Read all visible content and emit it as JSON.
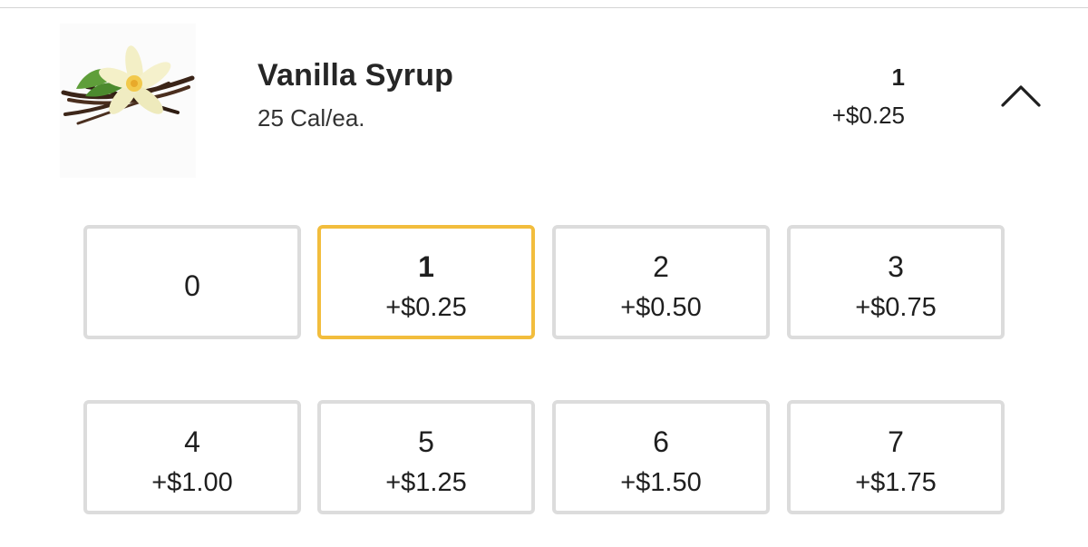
{
  "item": {
    "name": "Vanilla Syrup",
    "calories": "25 Cal/ea.",
    "image_icon": "vanilla-flower-icon"
  },
  "selection": {
    "quantity": "1",
    "price": "+$0.25",
    "collapse_icon": "chevron-up-icon"
  },
  "options": [
    {
      "qty": "0",
      "price": "",
      "selected": false
    },
    {
      "qty": "1",
      "price": "+$0.25",
      "selected": true
    },
    {
      "qty": "2",
      "price": "+$0.50",
      "selected": false
    },
    {
      "qty": "3",
      "price": "+$0.75",
      "selected": false
    },
    {
      "qty": "4",
      "price": "+$1.00",
      "selected": false
    },
    {
      "qty": "5",
      "price": "+$1.25",
      "selected": false
    },
    {
      "qty": "6",
      "price": "+$1.50",
      "selected": false
    },
    {
      "qty": "7",
      "price": "+$1.75",
      "selected": false
    }
  ],
  "colors": {
    "selected_border": "#f2bd3d",
    "default_border": "#dcdcdc",
    "text": "#1f1f1f"
  }
}
